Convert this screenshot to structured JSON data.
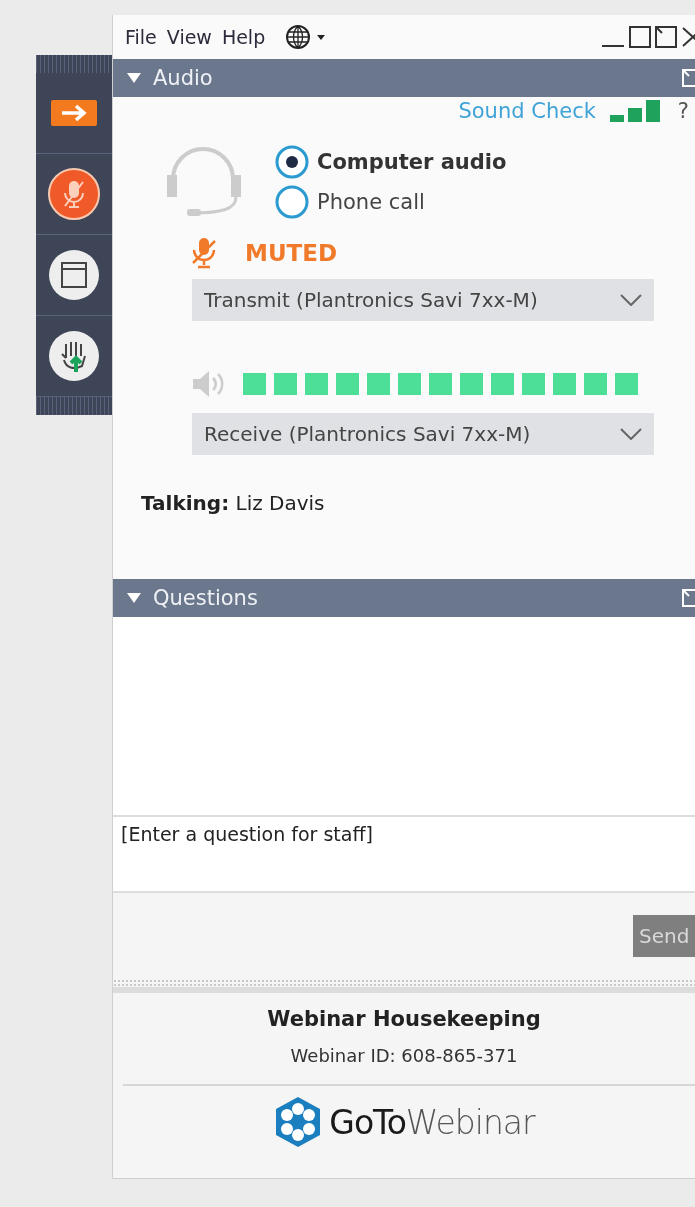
{
  "menu": [
    "File",
    "View",
    "Help"
  ],
  "audio": {
    "title": "Audio",
    "expanded": true,
    "sound_check": "Sound Check",
    "help": "?",
    "modes": [
      {
        "label": "Computer audio",
        "selected": true
      },
      {
        "label": "Phone call",
        "selected": false
      }
    ],
    "muted": true,
    "muted_label": "MUTED",
    "transmit": "Transmit (Plantronics Savi 7xx-M)",
    "receive": "Receive (Plantronics Savi 7xx-M)",
    "talking": "**Talking:** Liz Davis"
  },
  "questions": {
    "title": "Questions",
    "expanded": true,
    "placeholder": "[Enter a question for staff]",
    "send": {
      "label": "Send",
      "disabled": true
    }
  },
  "footer": {
    "title": "Webinar Housekeeping",
    "webinar_id": "Webinar ID: 608-865-371",
    "logo": "**GoTo**Webinar"
  }
}
